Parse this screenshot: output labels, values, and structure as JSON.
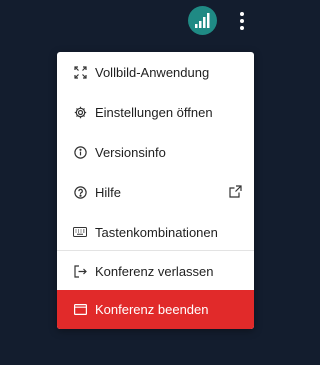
{
  "topbar": {
    "signal_button": {
      "icon": "signal-bars-icon",
      "color": "#1f8a84"
    },
    "more_button": {
      "icon": "more-vertical-icon"
    }
  },
  "menu": {
    "items": [
      {
        "label": "Vollbild-Anwendung",
        "icon": "fullscreen-icon"
      },
      {
        "label": "Einstellungen öffnen",
        "icon": "settings-gear-icon"
      },
      {
        "label": "Versionsinfo",
        "icon": "info-icon"
      },
      {
        "label": "Hilfe",
        "icon": "help-icon",
        "trailing_icon": "external-link-icon"
      },
      {
        "label": "Tastenkombinationen",
        "icon": "keyboard-icon"
      },
      {
        "label": "Konferenz verlassen",
        "icon": "leave-icon"
      },
      {
        "label": "Konferenz beenden",
        "icon": "end-conference-icon",
        "color": "#e12a2a"
      }
    ]
  }
}
